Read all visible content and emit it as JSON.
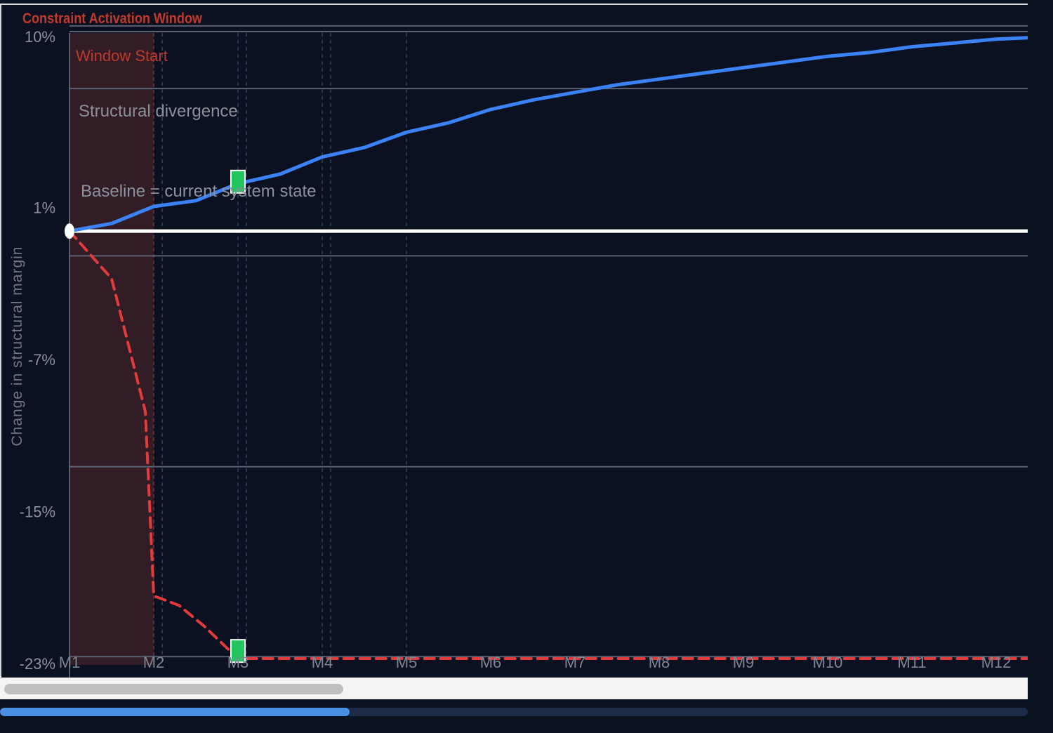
{
  "chart_data": {
    "type": "line",
    "title": "Constraint Activation Window",
    "ylabel": "Change in structural margin",
    "xlabel": "",
    "categories": [
      "M1",
      "M2",
      "M3",
      "M4",
      "M5",
      "M6",
      "M7",
      "M8",
      "M9",
      "M10",
      "M11",
      "M12"
    ],
    "y_ticks": [
      {
        "value": 10,
        "label": "10%"
      },
      {
        "value": 1,
        "label": "1%"
      },
      {
        "value": -7,
        "label": "-7%"
      },
      {
        "value": -15,
        "label": "-15%"
      },
      {
        "value": -23,
        "label": "-23%"
      }
    ],
    "ylim": [
      -23,
      10
    ],
    "grid": true,
    "series": [
      {
        "name": "",
        "style": "solid",
        "color": "#3b82f6",
        "x": [
          1,
          1.5,
          2,
          2.5,
          3,
          3.5,
          4,
          4.5,
          5,
          5.5,
          6,
          6.5,
          7,
          7.5,
          8,
          8.5,
          9,
          9.5,
          10,
          10.5,
          11,
          11.5,
          12,
          12.5
        ],
        "values": [
          -0.5,
          -0.1,
          0.8,
          1.1,
          2.0,
          2.5,
          3.4,
          3.9,
          4.7,
          5.2,
          5.9,
          6.4,
          6.8,
          7.2,
          7.5,
          7.8,
          8.1,
          8.4,
          8.7,
          8.9,
          9.2,
          9.4,
          9.6,
          9.7
        ]
      },
      {
        "name": "",
        "style": "dashed",
        "color": "#e23b3b",
        "x": [
          1,
          1.5,
          1.9,
          2,
          2.3,
          2.6,
          3,
          3.5,
          4,
          5,
          6,
          7,
          8,
          9,
          10,
          11,
          12,
          12.5
        ],
        "values": [
          -0.5,
          -3,
          -10,
          -19.7,
          -20.2,
          -21.3,
          -23,
          -23,
          -23,
          -23,
          -23,
          -23,
          -23,
          -23,
          -23,
          -23,
          -23,
          -23
        ]
      }
    ],
    "baseline": {
      "value": -0.5,
      "label": "Baseline = current system state",
      "color": "#ffffff"
    },
    "reference_lines": [
      {
        "value": 10.3
      },
      {
        "value": 10
      },
      {
        "value": 7.0
      },
      {
        "value": -1.8
      },
      {
        "value": -12.9
      },
      {
        "value": -22.9
      }
    ],
    "annotations": [
      {
        "text": "Window Start",
        "color": "#c0392b"
      },
      {
        "text": "Structural divergence",
        "color": "#8a8f99"
      }
    ],
    "shaded_region": {
      "x_start": 1,
      "x_end": 2,
      "color": "#3a1e28",
      "label": "Constraint Activation Window"
    },
    "vertical_guides": [
      2.1,
      3,
      3.1,
      4,
      4.1,
      5
    ],
    "markers": [
      {
        "series": 0,
        "x": 3,
        "y": 2.1,
        "color": "#22c55e"
      },
      {
        "series": 1,
        "x": 3,
        "y": -22.6,
        "color": "#22c55e"
      }
    ],
    "origin_marker": {
      "x": 1,
      "y": -0.5,
      "color": "#ffffff"
    }
  },
  "scrollbar": {
    "thumb_fraction": 0.33
  },
  "progress": {
    "fraction": 0.34
  }
}
